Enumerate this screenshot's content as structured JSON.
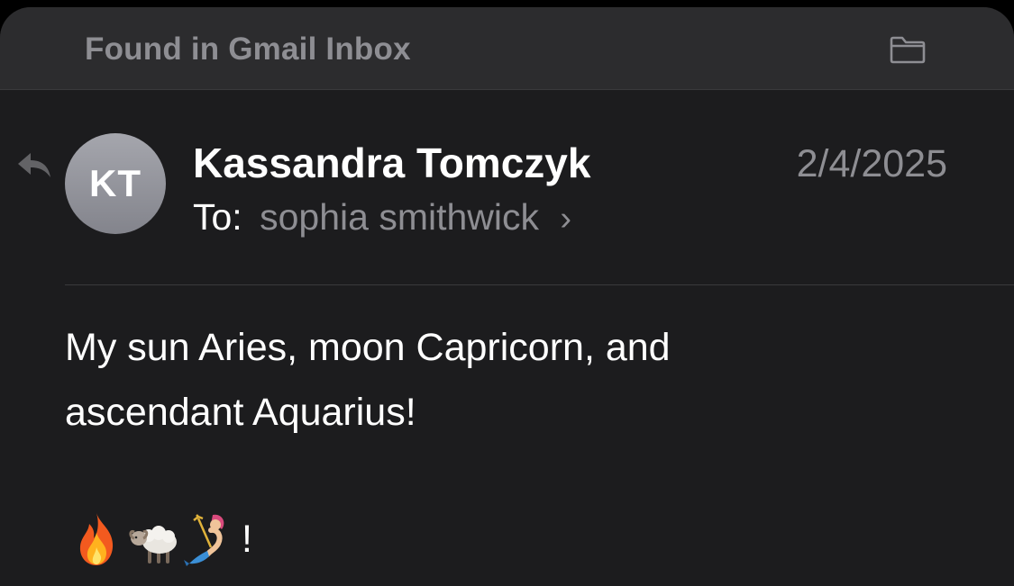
{
  "header": {
    "title": "Found in Gmail Inbox",
    "folder_icon": "folder-icon"
  },
  "message": {
    "avatar_initials": "KT",
    "sender": "Kassandra Tomczyk",
    "date": "2/4/2025",
    "to_label": "To:",
    "recipient": "sophia smithwick",
    "chevron": "›",
    "body_lines": [
      "My sun Aries, moon Capricorn, and",
      "ascendant Aquarius!"
    ],
    "emoji_icons": [
      "fire-emoji",
      "sheep-emoji",
      "merperson-emoji"
    ],
    "emoji_trailing": "!"
  },
  "colors": {
    "background": "#1c1c1e",
    "header_background": "#2c2c2e",
    "secondary_text": "#8e8e93",
    "primary_text": "#ffffff"
  }
}
